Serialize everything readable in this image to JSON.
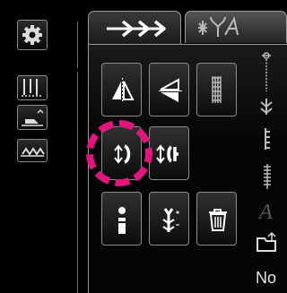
{
  "colors": {
    "highlight": "#e0157e",
    "border": "#8c8c8c"
  },
  "sidebar": {
    "items": [
      {
        "icon": "gear-icon"
      },
      {
        "icon": "needle-position-icon"
      },
      {
        "icon": "presser-foot-icon"
      },
      {
        "icon": "feed-dog-icon"
      }
    ]
  },
  "tabs": [
    {
      "icon": "stitch-pattern-icon",
      "active": true
    },
    {
      "icon": "embroidery-alphabet-icon",
      "active": false
    }
  ],
  "pattern_buttons": [
    {
      "icon": "mirror-vertical-icon"
    },
    {
      "icon": "mirror-horizontal-icon"
    },
    {
      "icon": "stitch-density-icon"
    },
    {
      "icon": "stitch-length-icon",
      "highlighted": true
    },
    {
      "icon": "stitch-width-icon"
    },
    {
      "icon": "single-pattern-icon"
    },
    {
      "icon": "tension-icon"
    },
    {
      "icon": "delete-icon"
    }
  ],
  "right_column": {
    "icons": [
      "presser-foot-pressure-icon",
      "needle-icon",
      "stitch-sample-1-icon",
      "stitch-sample-2-icon",
      "alphabet-icon",
      "folder-icon"
    ],
    "italic_letter": "A",
    "bottom_label": "No"
  }
}
